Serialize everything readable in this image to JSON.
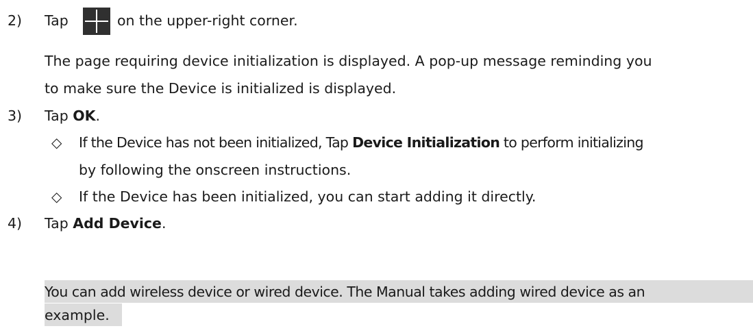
{
  "steps": [
    {
      "number": "2)",
      "pre": "Tap",
      "post": "on the upper-right corner."
    },
    {
      "number": "3)",
      "pre": "Tap ",
      "bold": "OK",
      "post": "."
    },
    {
      "number": "4)",
      "pre": "Tap ",
      "bold": "Add Device",
      "post": "."
    }
  ],
  "step2_desc": [
    "The page requiring device initialization is displayed. A pop-up message reminding you",
    "to make sure the Device is initialized is displayed."
  ],
  "bullet_symbol": "◇",
  "bullets": [
    {
      "pre": "If the Device has not been initialized, Tap ",
      "bold": "Device Initialization",
      "post": " to perform initializing"
    },
    {
      "cont": "by following the onscreen instructions."
    },
    {
      "pre": "If the Device has been initialized, you can start adding it directly."
    }
  ],
  "note_icon": "book-note-icon",
  "note_lines": [
    "You can add wireless device or wired device. The Manual takes adding wired device as an",
    "example."
  ]
}
